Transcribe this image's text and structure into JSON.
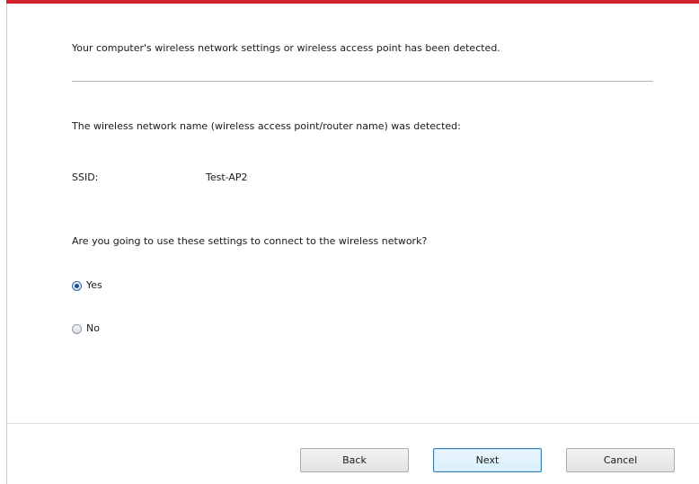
{
  "dialog": {
    "detected_message": "Your computer's wireless network settings or wireless access point has been detected.",
    "ssid_detected_message": "The wireless network name (wireless access point/router name) was detected:",
    "ssid_label": "SSID:",
    "ssid_value": "Test-AP2",
    "question": "Are you going to use these settings to connect to the wireless network?",
    "options": [
      {
        "label": "Yes",
        "selected": true
      },
      {
        "label": "No",
        "selected": false
      }
    ]
  },
  "buttons": {
    "back": "Back",
    "next": "Next",
    "cancel": "Cancel"
  },
  "colors": {
    "accent": "#d2232a",
    "default_button_border": "#3c7fb1"
  }
}
